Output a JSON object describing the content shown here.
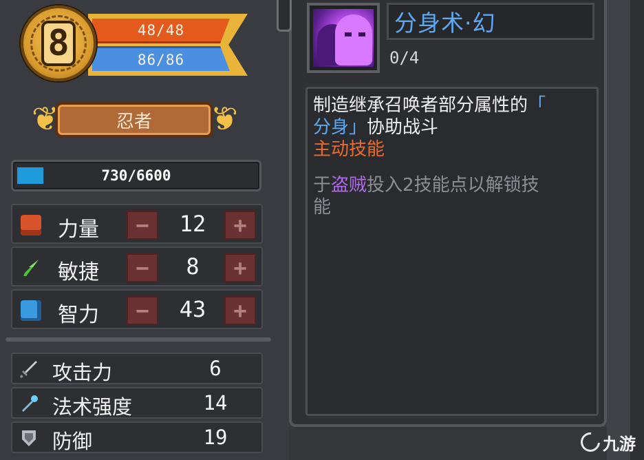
{
  "character": {
    "level": "8",
    "hp": "48/48",
    "mp": "86/86",
    "class_name": "忍者",
    "xp_text": "730/6600",
    "xp_fraction": 0.11
  },
  "attributes": [
    {
      "label": "力量",
      "value": "12",
      "icon": "fist-icon",
      "icon_color": "#d8542a"
    },
    {
      "label": "敏捷",
      "value": "8",
      "icon": "feather-icon",
      "icon_color": "#4ec43a"
    },
    {
      "label": "智力",
      "value": "43",
      "icon": "book-icon",
      "icon_color": "#3a9ae0"
    }
  ],
  "buttons": {
    "minus": "−",
    "plus": "+"
  },
  "stats": [
    {
      "label": "攻击力",
      "value": "6",
      "icon": "sword-icon"
    },
    {
      "label": "法术强度",
      "value": "14",
      "icon": "wand-icon"
    },
    {
      "label": "防御",
      "value": "19",
      "icon": "shield-icon"
    }
  ],
  "skill": {
    "title": "分身术·幻",
    "level": "0/4",
    "desc_1a": "制造继承召唤者部分属性的",
    "desc_1b": "「",
    "desc_2a": "分身」",
    "desc_2b": "协助战斗",
    "type": "主动技能",
    "unlock_1a": "于",
    "unlock_1b": "盗贼",
    "unlock_1c": "投入2技能点以解锁技",
    "unlock_2": "能"
  },
  "watermark": {
    "text": "九游"
  },
  "colors": {
    "hp": "#e45a1c",
    "mp": "#4a8fe0",
    "xp": "#1e9bd8",
    "skill_title": "#5ea8f0",
    "skill_type": "#ee6a2c",
    "class_highlight": "#b06ae8"
  }
}
